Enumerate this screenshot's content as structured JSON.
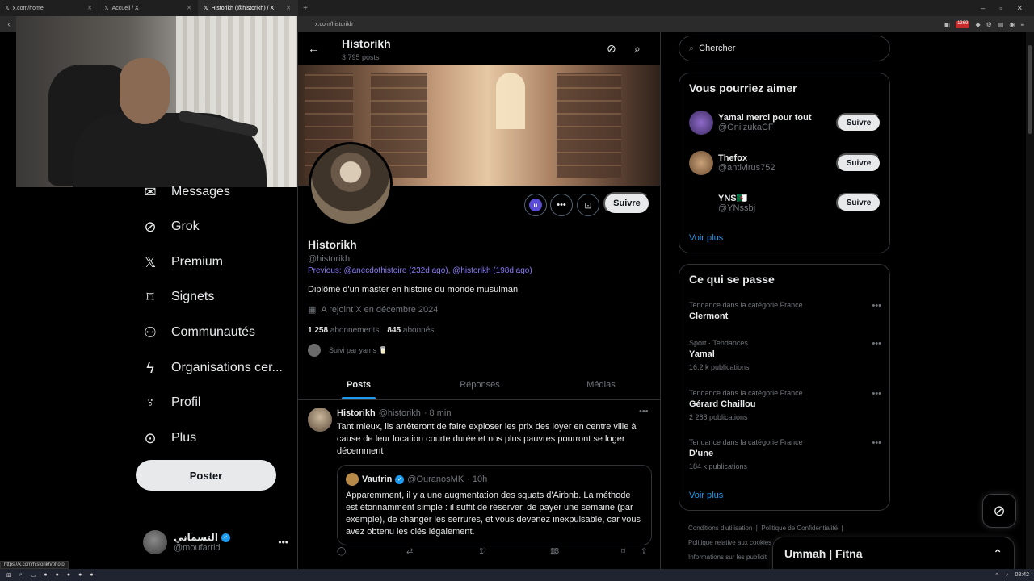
{
  "browser": {
    "tabs": [
      {
        "label": "x.com/home"
      },
      {
        "label": "Accueil / X"
      },
      {
        "label": "Historikh (@historikh) / X"
      }
    ],
    "url": "x.com/historikh",
    "ext_badge": "1369",
    "status_url": "https://x.com/historikh/photo"
  },
  "nav": {
    "items": [
      {
        "label": "Messages"
      },
      {
        "label": "Grok"
      },
      {
        "label": "Premium"
      },
      {
        "label": "Signets"
      },
      {
        "label": "Communautés"
      },
      {
        "label": "Organisations cer..."
      },
      {
        "label": "Profil"
      },
      {
        "label": "Plus"
      }
    ],
    "post_label": "Poster",
    "account": {
      "name": "التسماني",
      "handle": "@moufarrid"
    }
  },
  "profile": {
    "name": "Historikh",
    "post_count": "3 795 posts",
    "handle": "@historikh",
    "previous": "Previous: @anecdothistoire (232d ago), @historikh (198d ago)",
    "bio": "Diplômé d'un master en histoire du monde musulman",
    "joined": "A rejoint X en décembre 2024",
    "following_count": "1 258",
    "following_label": "abonnements",
    "followers_count": "845",
    "followers_label": "abonnés",
    "followed_by": "Suivi par yams 🥛",
    "badge_letter": "u",
    "follow_label": "Suivre",
    "tabs": [
      {
        "label": "Posts"
      },
      {
        "label": "Réponses"
      },
      {
        "label": "Médias"
      }
    ]
  },
  "tweet": {
    "name": "Historikh",
    "handle": "@historikh",
    "time": "· 8 min",
    "text": "Tant mieux, ils arrêteront de faire exploser les prix des loyer en centre ville à cause de leur location courte durée et nos plus pauvres pourront se loger décemment",
    "quote": {
      "name": "Vautrin",
      "handle": "@OuranosMK",
      "time": "· 10h",
      "text": "Apparemment, il y a une augmentation des squats d'Airbnb. La méthode est étonnamment simple : il suffit de réserver, de payer une semaine (par exemple), de changer les serrures, et vous devenez inexpulsable, car vous avez obtenu les clés légalement."
    },
    "likes": "1",
    "views": "13"
  },
  "sidebar": {
    "search_placeholder": "Chercher",
    "who_to_follow_title": "Vous pourriez aimer",
    "suggestions": [
      {
        "name": "Yamal merci pour tout",
        "handle": "@OniizukaCF",
        "button": "Suivre"
      },
      {
        "name": "Thefox",
        "handle": "@antivirus752",
        "button": "Suivre"
      },
      {
        "name": "YNS🇩🇿",
        "handle": "@YNssbj",
        "button": "Suivre"
      }
    ],
    "show_more": "Voir plus",
    "trends_title": "Ce qui se passe",
    "trends": [
      {
        "category": "Tendance dans la catégorie France",
        "name": "Clermont",
        "count": ""
      },
      {
        "category": "Sport · Tendances",
        "name": "Yamal",
        "count": "16,2 k publications"
      },
      {
        "category": "Tendance dans la catégorie France",
        "name": "Gérard Chaillou",
        "count": "2 288 publications"
      },
      {
        "category": "Tendance dans la catégorie France",
        "name": "D'une",
        "count": "184 k publications"
      }
    ],
    "trends_more": "Voir plus",
    "footer": {
      "terms": "Conditions d'utilisation",
      "privacy": "Politique de Confidentialité",
      "cookies": "Politique relative aux cookies",
      "ads": "Informations sur les publicit"
    }
  },
  "messages_drawer": {
    "title": "Ummah | Fitna"
  },
  "taskbar": {
    "time": "08:42"
  }
}
